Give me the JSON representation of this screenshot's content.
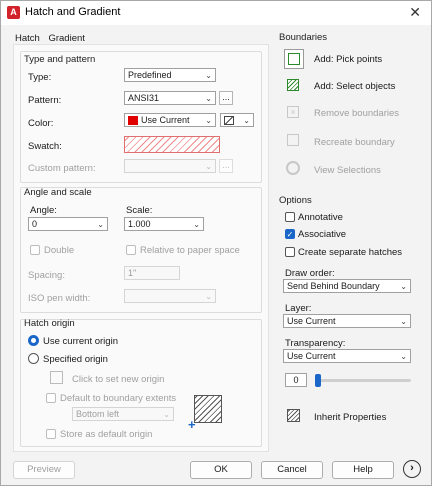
{
  "window": {
    "title": "Hatch and Gradient",
    "close_glyph": "✕"
  },
  "tabs": [
    {
      "label": "Hatch"
    },
    {
      "label": "Gradient"
    }
  ],
  "type_pattern": {
    "heading": "Type and pattern",
    "type_label": "Type:",
    "type_value": "Predefined",
    "pattern_label": "Pattern:",
    "pattern_value": "ANSI31",
    "color_label": "Color:",
    "color_value": "Use Current",
    "swatch_label": "Swatch:",
    "custom_pattern_label": "Custom pattern:",
    "browse": "..."
  },
  "angle_scale": {
    "heading": "Angle and scale",
    "angle_label": "Angle:",
    "angle_value": "0",
    "scale_label": "Scale:",
    "scale_value": "1.000",
    "double_label": "Double",
    "relative_label": "Relative to paper space",
    "spacing_label": "Spacing:",
    "spacing_value": "1\"",
    "iso_label": "ISO pen width:"
  },
  "origin": {
    "heading": "Hatch origin",
    "use_current": "Use current origin",
    "specified": "Specified origin",
    "click_set": "Click to set new origin",
    "default_extents": "Default to boundary extents",
    "position": "Bottom left",
    "store_default": "Store as default origin"
  },
  "boundaries": {
    "heading": "Boundaries",
    "add_pick": "Add: Pick points",
    "add_select": "Add: Select objects",
    "remove": "Remove boundaries",
    "recreate": "Recreate boundary",
    "view": "View Selections"
  },
  "options": {
    "heading": "Options",
    "annotative": "Annotative",
    "associative": "Associative",
    "separate": "Create separate hatches",
    "draw_order_label": "Draw order:",
    "draw_order_value": "Send Behind Boundary",
    "layer_label": "Layer:",
    "layer_value": "Use Current",
    "transparency_label": "Transparency:",
    "transparency_value": "Use Current",
    "transparency_number": "0",
    "inherit": "Inherit Properties"
  },
  "footer": {
    "preview": "Preview",
    "ok": "OK",
    "cancel": "Cancel",
    "help": "Help"
  },
  "colors": {
    "accent": "#1a66c9",
    "red_swatch": "#e00000"
  }
}
